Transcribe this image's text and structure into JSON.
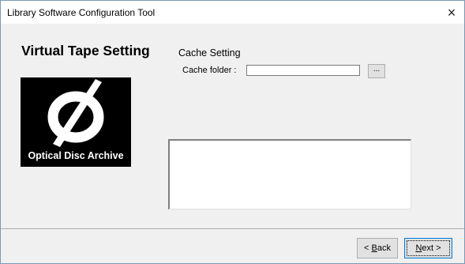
{
  "window": {
    "title": "Library Software Configuration Tool",
    "close_glyph": "×"
  },
  "page": {
    "heading": "Virtual Tape Setting",
    "section": "Cache Setting",
    "cache_folder_label": "Cache folder :",
    "cache_folder_value": "",
    "browse_label": "..."
  },
  "logo": {
    "text": "Optical Disc Archive",
    "icon": "optical-disc-archive-logo"
  },
  "footer": {
    "back_label_prefix": "< ",
    "back_label_accel": "B",
    "back_label_rest": "ack",
    "next_label_accel": "N",
    "next_label_rest": "ext >"
  }
}
